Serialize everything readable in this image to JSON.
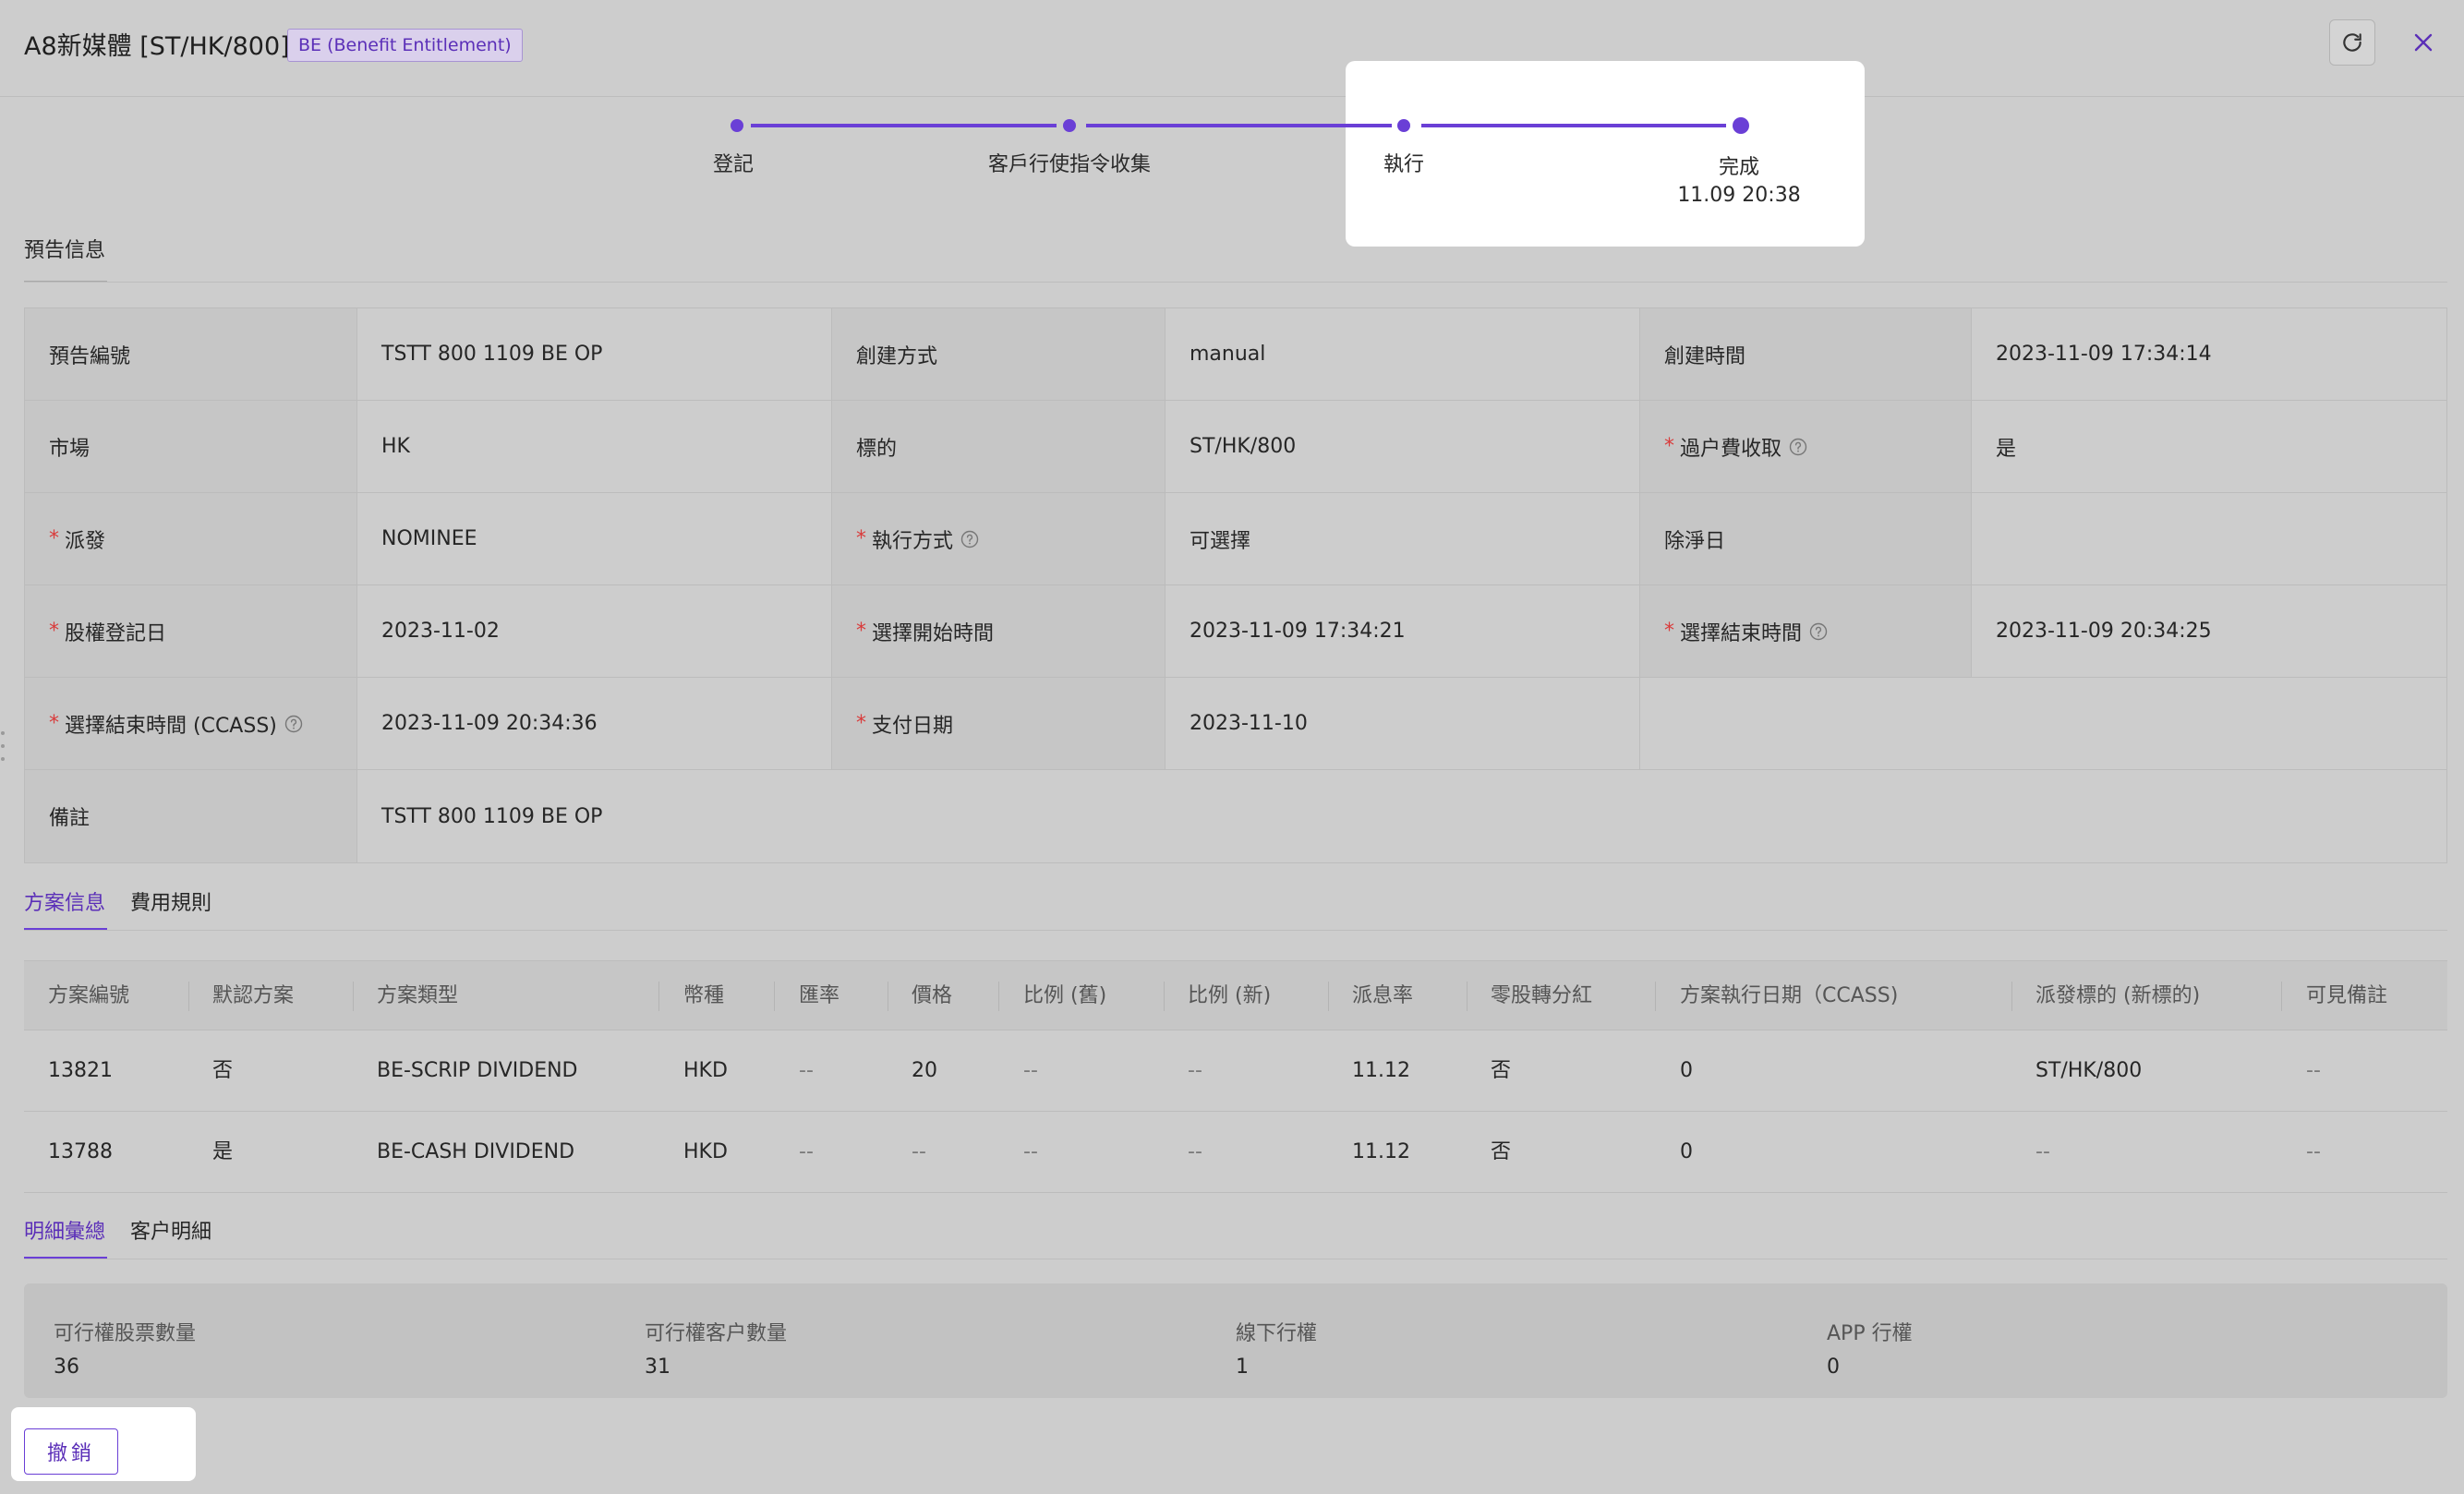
{
  "header": {
    "title": "A8新媒體 [ST/HK/800]",
    "badge": "BE (Benefit Entitlement)"
  },
  "stepper": {
    "steps": [
      {
        "label": "登記",
        "time": ""
      },
      {
        "label": "客戶行使指令收集",
        "time": ""
      },
      {
        "label": "執行",
        "time": ""
      },
      {
        "label": "完成",
        "time": "11.09 20:38"
      }
    ],
    "accent_color": "#6a3fd6"
  },
  "info_section": {
    "title": "預告信息",
    "rows": [
      [
        {
          "label": "預告編號",
          "required": false,
          "help": false,
          "value": "TSTT 800 1109 BE OP"
        },
        {
          "label": "創建方式",
          "required": false,
          "help": false,
          "value": "manual"
        },
        {
          "label": "創建時間",
          "required": false,
          "help": false,
          "value": "2023-11-09 17:34:14"
        }
      ],
      [
        {
          "label": "市場",
          "required": false,
          "help": false,
          "value": "HK"
        },
        {
          "label": "標的",
          "required": false,
          "help": false,
          "value": "ST/HK/800"
        },
        {
          "label": "過户費收取",
          "required": true,
          "help": true,
          "value": "是"
        }
      ],
      [
        {
          "label": "派發",
          "required": true,
          "help": false,
          "value": "NOMINEE"
        },
        {
          "label": "執行方式",
          "required": true,
          "help": true,
          "value": "可選擇"
        },
        {
          "label": "除淨日",
          "required": false,
          "help": false,
          "value": ""
        }
      ],
      [
        {
          "label": "股權登記日",
          "required": true,
          "help": false,
          "value": "2023-11-02"
        },
        {
          "label": "選擇開始時間",
          "required": true,
          "help": false,
          "value": "2023-11-09 17:34:21"
        },
        {
          "label": "選擇結束時間",
          "required": true,
          "help": true,
          "value": "2023-11-09 20:34:25"
        }
      ],
      [
        {
          "label": "選擇結束時間 (CCASS)",
          "required": true,
          "help": true,
          "value": "2023-11-09 20:34:36"
        },
        {
          "label": "支付日期",
          "required": true,
          "help": false,
          "value": "2023-11-10"
        }
      ],
      [
        {
          "label": "備註",
          "required": false,
          "help": false,
          "value": "TSTT 800 1109 BE OP"
        }
      ]
    ]
  },
  "scheme_tabs": [
    "方案信息",
    "費用規則"
  ],
  "scheme_table": {
    "columns": [
      "方案編號",
      "默認方案",
      "方案類型",
      "幣種",
      "匯率",
      "價格",
      "比例 (舊)",
      "比例 (新)",
      "派息率",
      "零股轉分紅",
      "方案執行日期（CCASS)",
      "派發標的 (新標的)",
      "可見備註"
    ],
    "rows": [
      [
        "13821",
        "否",
        "BE-SCRIP DIVIDEND",
        "HKD",
        "--",
        "20",
        "--",
        "--",
        "11.12",
        "否",
        "0",
        "ST/HK/800",
        "--"
      ],
      [
        "13788",
        "是",
        "BE-CASH DIVIDEND",
        "HKD",
        "--",
        "--",
        "--",
        "--",
        "11.12",
        "否",
        "0",
        "--",
        "--"
      ]
    ]
  },
  "detail_tabs": [
    "明細彙總",
    "客户明細"
  ],
  "summary": [
    {
      "label": "可行權股票數量",
      "value": "36"
    },
    {
      "label": "可行權客户數量",
      "value": "31"
    },
    {
      "label": "線下行權",
      "value": "1"
    },
    {
      "label": "APP 行權",
      "value": "0"
    }
  ],
  "actions": {
    "undo_label": "撤銷"
  }
}
